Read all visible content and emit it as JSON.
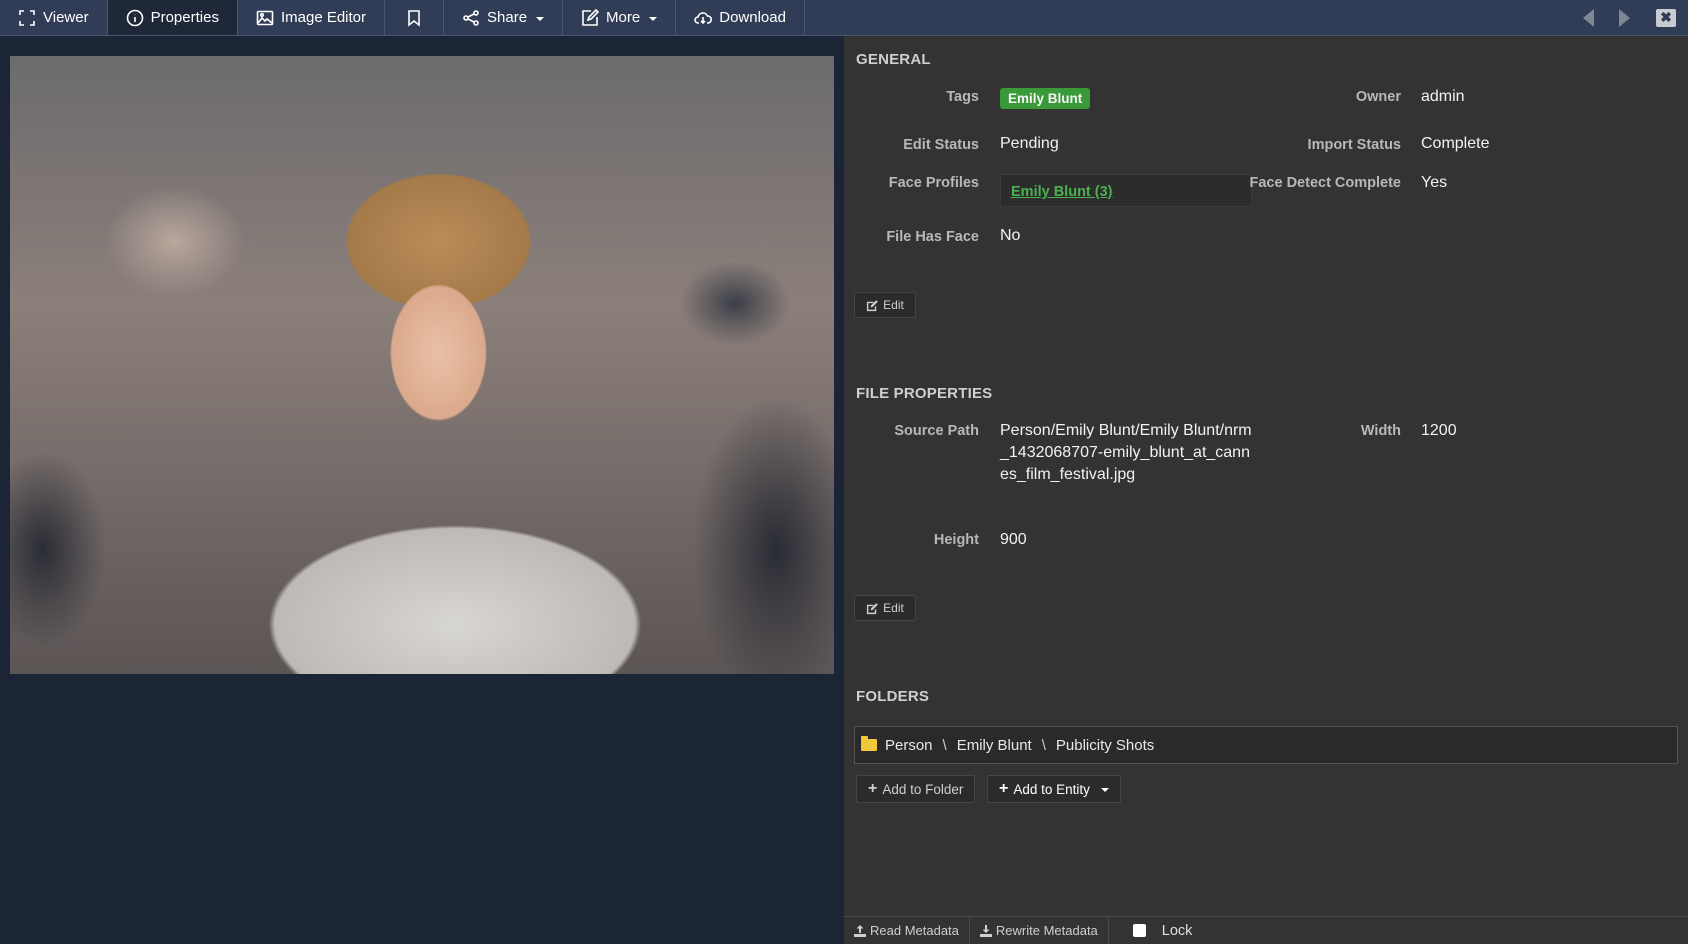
{
  "toolbar": {
    "tabs": [
      {
        "label": "Viewer",
        "icon": "viewer-icon",
        "active": false
      },
      {
        "label": "Properties",
        "icon": "info-icon",
        "active": true
      },
      {
        "label": "Image Editor",
        "icon": "image-icon",
        "active": false
      }
    ],
    "bookmark_icon": "bookmark-icon",
    "share_label": "Share",
    "more_label": "More",
    "download_label": "Download",
    "nav": {
      "prev": "previous-arrow",
      "next": "next-arrow",
      "close": "✖"
    }
  },
  "viewer": {
    "image_alt": "Photo of Emily Blunt at Cannes Film Festival"
  },
  "general": {
    "title": "GENERAL",
    "tags_label": "Tags",
    "tags": [
      "Emily Blunt"
    ],
    "owner_label": "Owner",
    "owner": "admin",
    "edit_status_label": "Edit Status",
    "edit_status": "Pending",
    "import_status_label": "Import Status",
    "import_status": "Complete",
    "face_profiles_label": "Face Profiles",
    "face_profiles": [
      "Emily Blunt (3)"
    ],
    "face_detect_label": "Face Detect Complete",
    "face_detect": "Yes",
    "file_has_face_label": "File Has Face",
    "file_has_face": "No",
    "edit_label": "Edit"
  },
  "file_properties": {
    "title": "FILE PROPERTIES",
    "source_path_label": "Source Path",
    "source_path": "Person/Emily Blunt/Emily Blunt/nrm_1432068707-emily_blunt_at_cannes_film_festival.jpg",
    "width_label": "Width",
    "width": "1200",
    "height_label": "Height",
    "height": "900",
    "edit_label": "Edit"
  },
  "folders": {
    "title": "FOLDERS",
    "path": [
      "Person",
      "Emily Blunt",
      "Publicity Shots"
    ],
    "separator": "\\",
    "add_to_folder_label": "Add to Folder",
    "add_to_entity_label": "Add to Entity"
  },
  "footer": {
    "read_metadata_label": "Read Metadata",
    "rewrite_metadata_label": "Rewrite Metadata",
    "lock_label": "Lock",
    "lock_checked": false
  },
  "colors": {
    "toolbar_bg": "#313d56",
    "viewer_bg": "#1c2535",
    "panel_bg": "#333333",
    "tag_green": "#3a9a3a",
    "link_green": "#4caf50",
    "folder_yellow": "#f0c93a"
  }
}
